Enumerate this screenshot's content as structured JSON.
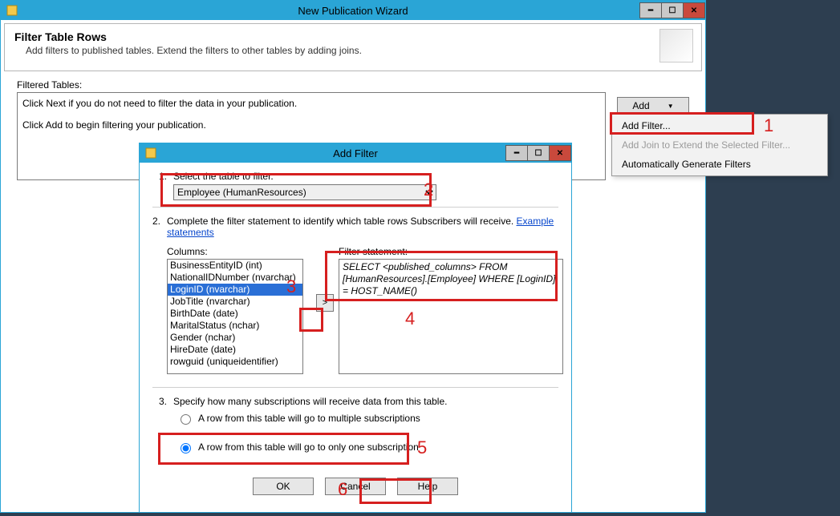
{
  "main_window": {
    "title": "New Publication Wizard",
    "header_title": "Filter Table Rows",
    "header_desc": "Add filters to published tables. Extend the filters to other tables by adding joins.",
    "filtered_label": "Filtered Tables:",
    "filtered_text1": "Click Next if you do not need to filter the data in your publication.",
    "filtered_text2": "Click Add to begin filtering your publication.",
    "add_btn": "Add"
  },
  "context_menu": {
    "items": [
      {
        "label": "Add Filter...",
        "disabled": false
      },
      {
        "label": "Add Join to Extend the Selected Filter...",
        "disabled": true
      },
      {
        "label": "Automatically Generate Filters",
        "disabled": false
      }
    ]
  },
  "add_filter": {
    "title": "Add Filter",
    "step1_label": "Select the table to filter.",
    "table_selected": "Employee (HumanResources)",
    "step2_label": "Complete the filter statement to identify which table rows Subscribers will receive. ",
    "example_link": "Example statements",
    "columns_label": "Columns:",
    "columns": [
      "BusinessEntityID (int)",
      "NationalIDNumber (nvarchar)",
      "LoginID (nvarchar)",
      "JobTitle (nvarchar)",
      "BirthDate (date)",
      "MaritalStatus (nchar)",
      "Gender (nchar)",
      "HireDate (date)",
      "rowguid (uniqueidentifier)"
    ],
    "selected_column_index": 2,
    "filter_label": "Filter statement:",
    "filter_text": "SELECT <published_columns> FROM [HumanResources].[Employee] WHERE [LoginID] = HOST_NAME()",
    "step3_label": "Specify how many subscriptions will receive data from this table.",
    "radio1": "A row from this table will go to multiple subscriptions",
    "radio2": "A row from this table will go to only one subscription",
    "radio_selected": 2,
    "ok": "OK",
    "cancel": "Cancel",
    "help": "Help",
    "move_btn": ">"
  },
  "annotations": {
    "n1": "1",
    "n2": "2",
    "n3": "3",
    "n4": "4",
    "n5": "5",
    "n6": "6"
  }
}
